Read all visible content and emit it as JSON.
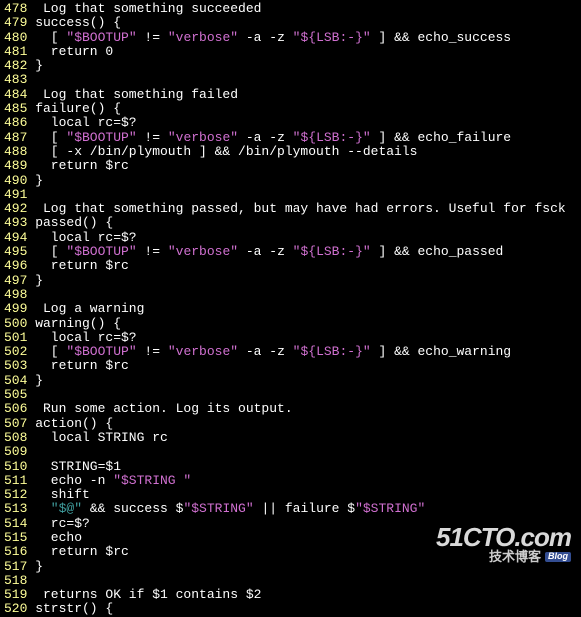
{
  "lines": [
    {
      "n": 478,
      "tokens": [
        {
          "c": "white",
          "t": " Log that something succeeded"
        }
      ]
    },
    {
      "n": 479,
      "tokens": [
        {
          "c": "white",
          "t": "success() {"
        }
      ]
    },
    {
      "n": 480,
      "tokens": [
        {
          "c": "white",
          "t": "  [ "
        },
        {
          "c": "magenta",
          "t": "\"$BOOTUP\""
        },
        {
          "c": "white",
          "t": " != "
        },
        {
          "c": "magenta",
          "t": "\"verbose\""
        },
        {
          "c": "white",
          "t": " -a -z "
        },
        {
          "c": "magenta",
          "t": "\"${LSB:-}\""
        },
        {
          "c": "white",
          "t": " ] && echo_success"
        }
      ]
    },
    {
      "n": 481,
      "tokens": [
        {
          "c": "white",
          "t": "  return 0"
        }
      ]
    },
    {
      "n": 482,
      "tokens": [
        {
          "c": "white",
          "t": "}"
        }
      ]
    },
    {
      "n": 483,
      "tokens": [
        {
          "c": "white",
          "t": ""
        }
      ]
    },
    {
      "n": 484,
      "tokens": [
        {
          "c": "white",
          "t": " Log that something failed"
        }
      ]
    },
    {
      "n": 485,
      "tokens": [
        {
          "c": "white",
          "t": "failure() {"
        }
      ]
    },
    {
      "n": 486,
      "tokens": [
        {
          "c": "white",
          "t": "  local rc=$?"
        }
      ]
    },
    {
      "n": 487,
      "tokens": [
        {
          "c": "white",
          "t": "  [ "
        },
        {
          "c": "magenta",
          "t": "\"$BOOTUP\""
        },
        {
          "c": "white",
          "t": " != "
        },
        {
          "c": "magenta",
          "t": "\"verbose\""
        },
        {
          "c": "white",
          "t": " -a -z "
        },
        {
          "c": "magenta",
          "t": "\"${LSB:-}\""
        },
        {
          "c": "white",
          "t": " ] && echo_failure"
        }
      ]
    },
    {
      "n": 488,
      "tokens": [
        {
          "c": "white",
          "t": "  [ -x /bin/plymouth ] && /bin/plymouth --details"
        }
      ]
    },
    {
      "n": 489,
      "tokens": [
        {
          "c": "white",
          "t": "  return $rc"
        }
      ]
    },
    {
      "n": 490,
      "tokens": [
        {
          "c": "white",
          "t": "}"
        }
      ]
    },
    {
      "n": 491,
      "tokens": [
        {
          "c": "white",
          "t": ""
        }
      ]
    },
    {
      "n": 492,
      "tokens": [
        {
          "c": "white",
          "t": " Log that something passed, but may have had errors. Useful for fsck"
        }
      ]
    },
    {
      "n": 493,
      "tokens": [
        {
          "c": "white",
          "t": "passed() {"
        }
      ]
    },
    {
      "n": 494,
      "tokens": [
        {
          "c": "white",
          "t": "  local rc=$?"
        }
      ]
    },
    {
      "n": 495,
      "tokens": [
        {
          "c": "white",
          "t": "  [ "
        },
        {
          "c": "magenta",
          "t": "\"$BOOTUP\""
        },
        {
          "c": "white",
          "t": " != "
        },
        {
          "c": "magenta",
          "t": "\"verbose\""
        },
        {
          "c": "white",
          "t": " -a -z "
        },
        {
          "c": "magenta",
          "t": "\"${LSB:-}\""
        },
        {
          "c": "white",
          "t": " ] && echo_passed"
        }
      ]
    },
    {
      "n": 496,
      "tokens": [
        {
          "c": "white",
          "t": "  return $rc"
        }
      ]
    },
    {
      "n": 497,
      "tokens": [
        {
          "c": "white",
          "t": "}"
        }
      ]
    },
    {
      "n": 498,
      "tokens": [
        {
          "c": "white",
          "t": ""
        }
      ]
    },
    {
      "n": 499,
      "tokens": [
        {
          "c": "white",
          "t": " Log a warning"
        }
      ]
    },
    {
      "n": 500,
      "tokens": [
        {
          "c": "white",
          "t": "warning() {"
        }
      ]
    },
    {
      "n": 501,
      "tokens": [
        {
          "c": "white",
          "t": "  local rc=$?"
        }
      ]
    },
    {
      "n": 502,
      "tokens": [
        {
          "c": "white",
          "t": "  [ "
        },
        {
          "c": "magenta",
          "t": "\"$BOOTUP\""
        },
        {
          "c": "white",
          "t": " != "
        },
        {
          "c": "magenta",
          "t": "\"verbose\""
        },
        {
          "c": "white",
          "t": " -a -z "
        },
        {
          "c": "magenta",
          "t": "\"${LSB:-}\""
        },
        {
          "c": "white",
          "t": " ] && echo_warning"
        }
      ]
    },
    {
      "n": 503,
      "tokens": [
        {
          "c": "white",
          "t": "  return $rc"
        }
      ]
    },
    {
      "n": 504,
      "tokens": [
        {
          "c": "white",
          "t": "}"
        }
      ]
    },
    {
      "n": 505,
      "tokens": [
        {
          "c": "white",
          "t": ""
        }
      ]
    },
    {
      "n": 506,
      "tokens": [
        {
          "c": "white",
          "t": " Run some action. Log its output."
        }
      ]
    },
    {
      "n": 507,
      "tokens": [
        {
          "c": "white",
          "t": "action() {"
        }
      ]
    },
    {
      "n": 508,
      "tokens": [
        {
          "c": "white",
          "t": "  local STRING rc"
        }
      ]
    },
    {
      "n": 509,
      "tokens": [
        {
          "c": "white",
          "t": ""
        }
      ]
    },
    {
      "n": 510,
      "tokens": [
        {
          "c": "white",
          "t": "  STRING=$1"
        }
      ]
    },
    {
      "n": 511,
      "tokens": [
        {
          "c": "white",
          "t": "  echo -n "
        },
        {
          "c": "magenta",
          "t": "\"$STRING \""
        }
      ]
    },
    {
      "n": 512,
      "tokens": [
        {
          "c": "white",
          "t": "  shift"
        }
      ]
    },
    {
      "n": 513,
      "tokens": [
        {
          "c": "white",
          "t": "  "
        },
        {
          "c": "teal",
          "t": "\"$@\""
        },
        {
          "c": "white",
          "t": " && success $"
        },
        {
          "c": "magenta",
          "t": "\"$STRING\""
        },
        {
          "c": "white",
          "t": " || failure $"
        },
        {
          "c": "magenta",
          "t": "\"$STRING\""
        }
      ]
    },
    {
      "n": 514,
      "tokens": [
        {
          "c": "white",
          "t": "  rc=$?"
        }
      ]
    },
    {
      "n": 515,
      "tokens": [
        {
          "c": "white",
          "t": "  echo"
        }
      ]
    },
    {
      "n": 516,
      "tokens": [
        {
          "c": "white",
          "t": "  return $rc"
        }
      ]
    },
    {
      "n": 517,
      "tokens": [
        {
          "c": "white",
          "t": "}"
        }
      ]
    },
    {
      "n": 518,
      "tokens": [
        {
          "c": "white",
          "t": ""
        }
      ]
    },
    {
      "n": 519,
      "tokens": [
        {
          "c": "white",
          "t": " returns OK if $1 contains $2"
        }
      ]
    },
    {
      "n": 520,
      "tokens": [
        {
          "c": "white",
          "t": "strstr() {"
        }
      ]
    }
  ],
  "watermark": {
    "logo": "51CTO.com",
    "sub": "技术博客",
    "badge": "Blog"
  }
}
